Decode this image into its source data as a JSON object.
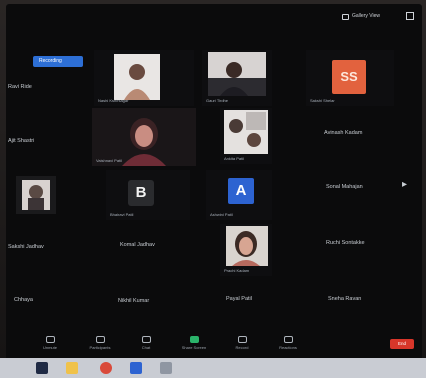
{
  "top": {
    "view_label": "Gallery View",
    "meeting_badge": "Recording"
  },
  "left_column": [
    {
      "name": "Ravi Ride"
    },
    {
      "name": "Ajit Shastri"
    },
    {
      "name": ""
    },
    {
      "name": "Sakshi Jadhav"
    },
    {
      "name": "Chhaya"
    }
  ],
  "grid": {
    "row1": [
      {
        "caption": "Nashi Kshirsagar",
        "kind": "video"
      },
      {
        "caption": "Gauri Tirdhe",
        "kind": "video"
      },
      {
        "caption": "Sakshi Shelar",
        "kind": "avatar",
        "initials": "SS"
      }
    ],
    "row2": [
      {
        "caption": "Vaishnavi Patil",
        "kind": "video"
      },
      {
        "caption": "Ankita Patil",
        "kind": "video"
      },
      {
        "name": "Avinash Kadam"
      }
    ],
    "row3": [
      {
        "caption": "Bhairavi Patil",
        "initials": "B"
      },
      {
        "caption": "Ashwini Patil",
        "initials": "A"
      },
      {
        "name": "Sonal Mahajan"
      }
    ],
    "row4": [
      {
        "name": "Komal Jadhav"
      },
      {
        "caption": "Prachi Kadam",
        "kind": "video"
      },
      {
        "name": "Ruchi Sontakke"
      }
    ],
    "row5": [
      {
        "name": "Nikhil Kumar"
      },
      {
        "name": "Payal Patil"
      },
      {
        "name": "Sneha Ravan"
      }
    ]
  },
  "toolbar": {
    "items": [
      "Unmute",
      "Participants",
      "Chat",
      "Share Screen",
      "Record",
      "Reactions"
    ],
    "end_label": "End"
  },
  "colors": {
    "accent_blue": "#2d63d1",
    "avatar_orange": "#e2623e",
    "end_red": "#d8362a",
    "share_green": "#2bb36a"
  }
}
